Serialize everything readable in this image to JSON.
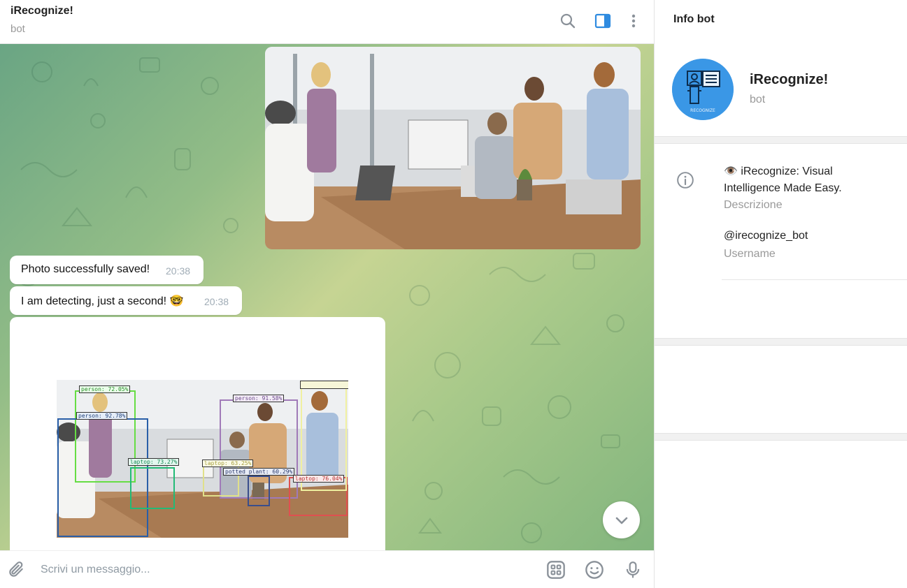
{
  "header": {
    "title": "iRecognize!",
    "subtitle": "bot"
  },
  "messages": [
    {
      "kind": "photo",
      "description_icon": "office-photo"
    },
    {
      "kind": "text",
      "text": "Photo successfully saved!",
      "time": "20:38"
    },
    {
      "kind": "text",
      "text": "I am detecting, just a second! 🤓",
      "time": "20:38"
    },
    {
      "kind": "photo",
      "description_icon": "detection-result-photo"
    }
  ],
  "detections": [
    {
      "label": "person: 72.05%",
      "color": "#66dd44"
    },
    {
      "label": "person: 92.78%",
      "color": "#2a5fa8"
    },
    {
      "label": "person: 91.58%",
      "color": "#a07ab8"
    },
    {
      "label": "laptop: 73.27%",
      "color": "#22bb77"
    },
    {
      "label": "laptop: 63.25%",
      "color": "#e0e08a"
    },
    {
      "label": "potted plant: 60.29%",
      "color": "#3a4e8c"
    },
    {
      "label": "laptop: 76.04%",
      "color": "#e05050"
    }
  ],
  "composer": {
    "placeholder": "Scrivi un messaggio..."
  },
  "info": {
    "panel_title": "Info bot",
    "bot_name": "iRecognize!",
    "bot_sub": "bot",
    "avatar_caption": "RECOGNIZE",
    "description": "👁️ iRecognize: Visual Intelligence Made Easy.",
    "description_label": "Descrizione",
    "username": "@irecognize_bot",
    "username_label": "Username"
  },
  "colors": {
    "accent": "#3a97e6",
    "chat_bg_start": "#6aa584",
    "chat_bg_mid": "#c6d493",
    "chat_bg_end": "#82b57e",
    "time_text": "#a0acb6",
    "secondary_text": "#999999"
  },
  "icons": {
    "search": "search-icon",
    "sidebar": "sidebar-toggle-icon",
    "more": "more-vertical-icon",
    "attach": "paperclip-icon",
    "commands": "bot-commands-icon",
    "emoji": "emoji-icon",
    "mic": "microphone-icon",
    "scroll_down": "chevron-down-icon",
    "info": "info-icon"
  }
}
